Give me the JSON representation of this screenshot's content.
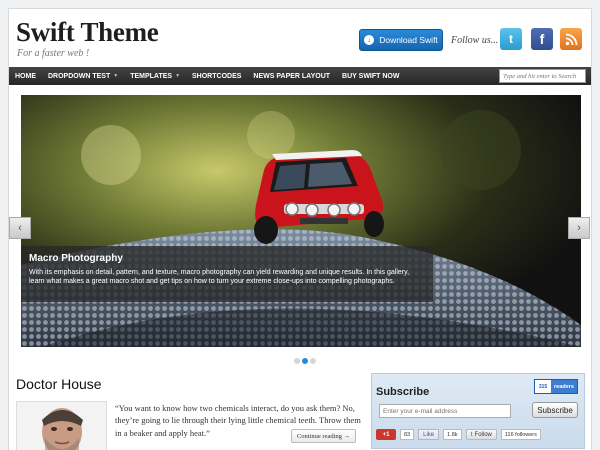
{
  "header": {
    "site_title": "Swift Theme",
    "tagline": "For a faster web !",
    "download_label": "Download Swift",
    "follow_label": "Follow us...",
    "social_icons": [
      "twitter-icon",
      "facebook-icon",
      "rss-icon"
    ]
  },
  "nav": {
    "items": [
      {
        "label": "HOME",
        "dropdown": false
      },
      {
        "label": "DROPDOWN TEST",
        "dropdown": true
      },
      {
        "label": "TEMPLATES",
        "dropdown": true
      },
      {
        "label": "SHORTCODES",
        "dropdown": false
      },
      {
        "label": "NEWS PAPER LAYOUT",
        "dropdown": false
      },
      {
        "label": "BUY SWIFT NOW",
        "dropdown": false
      }
    ],
    "search_placeholder": "Type and hit enter to Search"
  },
  "slider": {
    "caption_title": "Macro Photography",
    "caption_text": "With its emphasis on detail, pattern, and texture, macro photography can yield rewarding and unique results. In this gallery, learn what makes a great macro shot and get tips on how to turn your extreme close-ups into compelling photographs.",
    "prev_label": "‹",
    "next_label": "›",
    "dot_count": 3,
    "active_dot": 2
  },
  "post": {
    "title": "Doctor House",
    "excerpt": "“You want to know how two chemicals interact, do you ask them? No, they’re going to lie through their lying little chemical teeth. Throw them in a beaker and apply heat.”",
    "continue_label": "Continue reading →"
  },
  "subscribe": {
    "title": "Subscribe",
    "readers_count": "315",
    "readers_label": "readers",
    "email_placeholder": "Enter your e-mail address",
    "button_label": "Subscribe",
    "gplus_label": "+1",
    "gplus_count": "83",
    "like_label": "Like",
    "like_count": "1.8k",
    "follow_label": "Follow",
    "followers": "116 followers"
  },
  "colors": {
    "accent": "#1a6fc0",
    "nav_bg": "#333333",
    "subscribe_bg": "#d6e3f0"
  }
}
